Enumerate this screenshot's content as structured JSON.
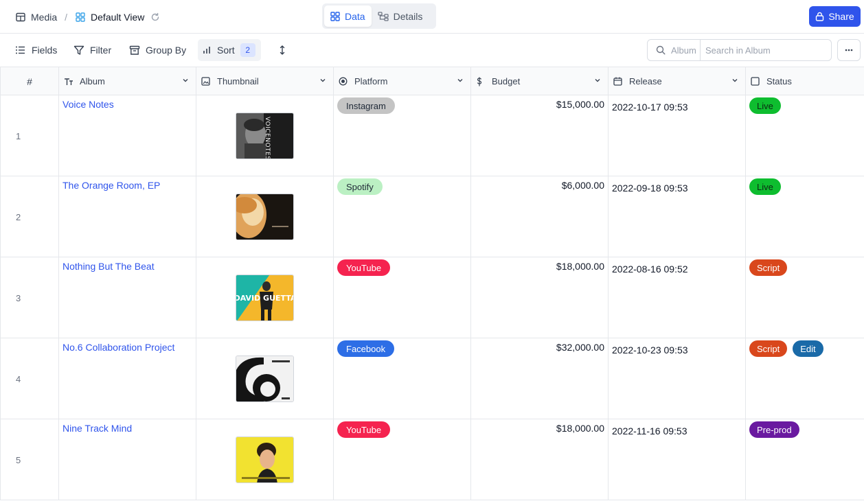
{
  "breadcrumb": {
    "parent": "Media",
    "separator": "/",
    "view": "Default View"
  },
  "view_tabs": [
    {
      "label": "Data",
      "active": true
    },
    {
      "label": "Details",
      "active": false
    }
  ],
  "share_label": "Share",
  "toolbar": {
    "fields": "Fields",
    "filter": "Filter",
    "group_by": "Group By",
    "sort": "Sort",
    "sort_count": "2"
  },
  "search": {
    "scope": "Album",
    "placeholder": "Search in Album",
    "value": ""
  },
  "columns": {
    "num": "#",
    "album": "Album",
    "thumbnail": "Thumbnail",
    "platform": "Platform",
    "budget": "Budget",
    "release": "Release",
    "status": "Status"
  },
  "colors": {
    "accent": "#2f54eb",
    "platform_Instagram": "#c4c4c4",
    "platform_Spotify": "#bbf0c3",
    "platform_YouTube": "#f5234f",
    "platform_Facebook": "#2d6ee6",
    "status_Live": "#0ebd2f",
    "status_Script": "#d9471c",
    "status_Edit": "#1a6aa8",
    "status_Pre-prod": "#6a1aa0"
  },
  "rows": [
    {
      "num": "1",
      "album": "Voice Notes",
      "platform": "Instagram",
      "budget": "$15,000.00",
      "release": "2022-10-17 09:53",
      "status": [
        "Live"
      ]
    },
    {
      "num": "2",
      "album": "The Orange Room, EP",
      "platform": "Spotify",
      "budget": "$6,000.00",
      "release": "2022-09-18 09:53",
      "status": [
        "Live"
      ]
    },
    {
      "num": "3",
      "album": "Nothing But The Beat",
      "platform": "YouTube",
      "budget": "$18,000.00",
      "release": "2022-08-16 09:52",
      "status": [
        "Script"
      ]
    },
    {
      "num": "4",
      "album": "No.6 Collaboration Project",
      "platform": "Facebook",
      "budget": "$32,000.00",
      "release": "2022-10-23 09:53",
      "status": [
        "Script",
        "Edit"
      ]
    },
    {
      "num": "5",
      "album": "Nine Track Mind",
      "platform": "YouTube",
      "budget": "$18,000.00",
      "release": "2022-11-16 09:53",
      "status": [
        "Pre-prod"
      ]
    }
  ],
  "thumbnails": {
    "voice_notes_text": "VOICENOTES",
    "david_guetta_text": "DAVID GUETTA"
  }
}
